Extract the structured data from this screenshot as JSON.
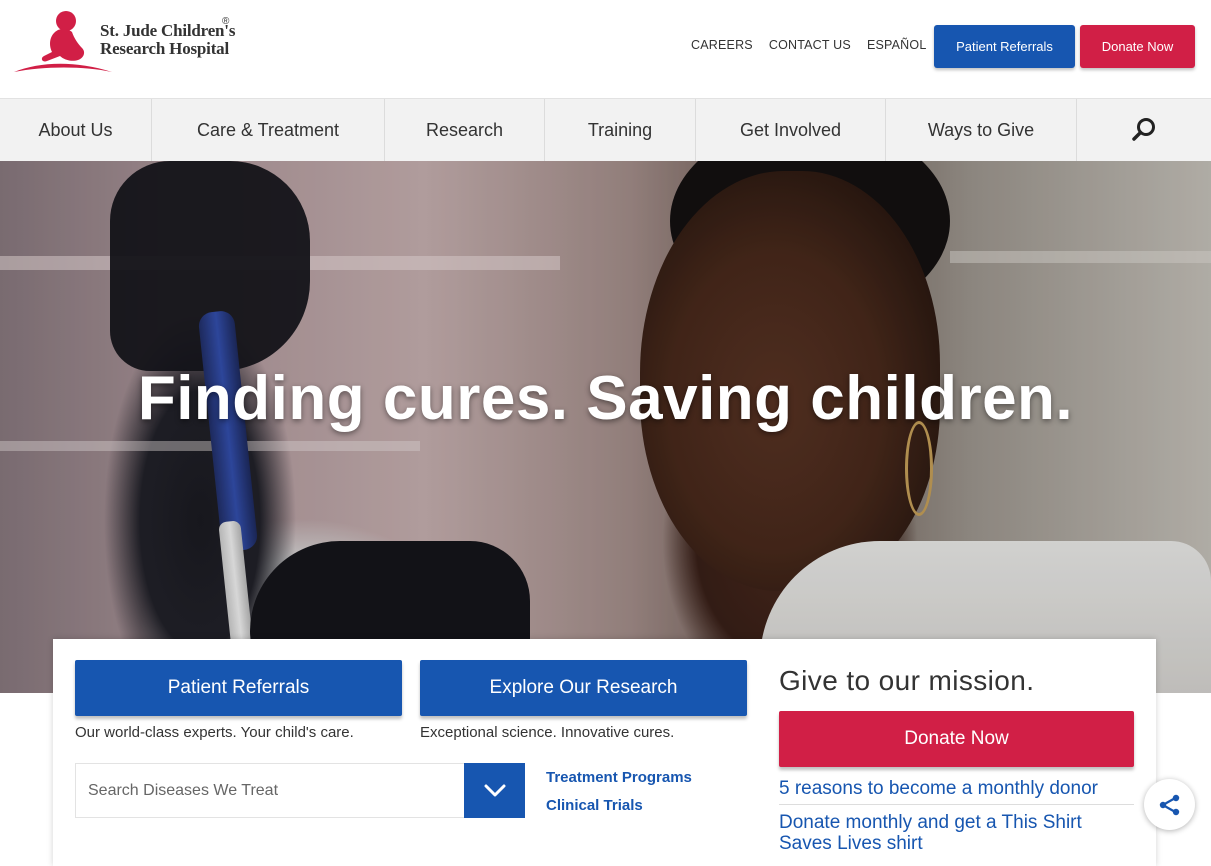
{
  "logo": {
    "line1": "St. Jude Children's",
    "line2": "Research Hospital",
    "reg": "®",
    "brand_color": "#d11f46"
  },
  "utility": {
    "links": [
      "CAREERS",
      "CONTACT US",
      "ESPAÑOL"
    ]
  },
  "header_buttons": {
    "referrals": "Patient Referrals",
    "donate": "Donate Now"
  },
  "nav": {
    "items": [
      "About Us",
      "Care & Treatment",
      "Research",
      "Training",
      "Get Involved",
      "Ways to Give"
    ],
    "search_icon": "search-icon"
  },
  "hero": {
    "title": "Finding cures. Saving children."
  },
  "panel": {
    "referrals": {
      "label": "Patient Referrals",
      "caption": "Our world-class experts. Your child's care."
    },
    "research": {
      "label": "Explore Our Research",
      "caption": "Exceptional science. Innovative cures."
    },
    "search": {
      "placeholder": "Search Diseases We Treat",
      "toggle_icon": "chevron-down-icon"
    },
    "links": [
      "Treatment Programs",
      "Clinical Trials"
    ],
    "mission": {
      "title": "Give to our mission.",
      "donate": "Donate Now",
      "link1": "5 reasons to become a monthly donor",
      "link2": "Donate monthly and get a This Shirt Saves Lives shirt"
    }
  },
  "share": {
    "icon": "share-icon"
  },
  "colors": {
    "primary_blue": "#1756b0",
    "donate_red": "#d11f46",
    "nav_bg": "#f2f2f2"
  }
}
